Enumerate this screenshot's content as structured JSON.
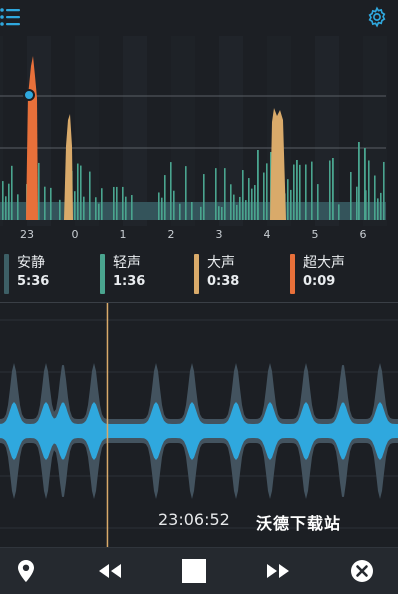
{
  "header": {
    "menu_icon": "menu-icon",
    "settings_icon": "gear-icon"
  },
  "chart_data": {
    "type": "bar",
    "title": "",
    "x_tick_labels": [
      "23",
      "0",
      "1",
      "2",
      "3",
      "4",
      "5",
      "6"
    ],
    "series": [
      {
        "name": "安静",
        "color": "#3a7c7c"
      },
      {
        "name": "轻声",
        "color": "#4aa58f"
      },
      {
        "name": "大声",
        "color": "#d9aa6a"
      },
      {
        "name": "超大声",
        "color": "#e8703a"
      }
    ],
    "grid": true
  },
  "legend": [
    {
      "label": "安静",
      "value": "5:36",
      "color": "#3d5f66"
    },
    {
      "label": "轻声",
      "value": "1:36",
      "color": "#4aa58f"
    },
    {
      "label": "大声",
      "value": "0:38",
      "color": "#d9aa6a"
    },
    {
      "label": "超大声",
      "value": "0:09",
      "color": "#e8703a"
    }
  ],
  "playback": {
    "time": "23:06:52",
    "progress": 0.27
  },
  "watermark": "沃德下载站",
  "controls": {
    "icons": [
      "location-pin-icon",
      "rewind-icon",
      "stop-icon",
      "fast-forward-icon",
      "close-circle-icon"
    ]
  },
  "colors": {
    "wave_core": "#2fa8de",
    "wave_outer": "#43535f",
    "playhead": "#d9aa6a",
    "background": "#1c1f24"
  }
}
